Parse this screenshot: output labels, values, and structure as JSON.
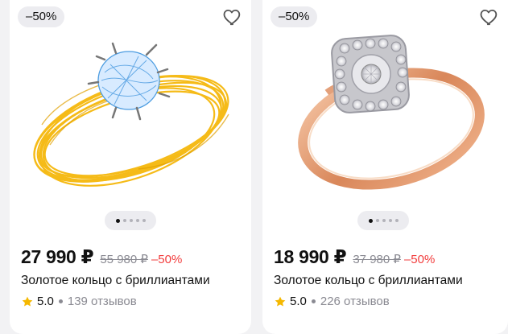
{
  "products": [
    {
      "badge": "–50%",
      "image_alt": "hand-drawn gold ring with blue stone",
      "price": "27 990 ₽",
      "old_price": "55 980 ₽",
      "discount": "–50%",
      "title": "Золотое кольцо с бриллиантами",
      "rating": "5.0",
      "reviews": "139 отзывов",
      "carousel": {
        "count": 5,
        "active": 1
      }
    },
    {
      "badge": "–50%",
      "image_alt": "rose gold ring with diamond cluster",
      "price": "18 990 ₽",
      "old_price": "37 980 ₽",
      "discount": "–50%",
      "title": "Золотое кольцо с бриллиантами",
      "rating": "5.0",
      "reviews": "226 отзывов",
      "carousel": {
        "count": 5,
        "active": 1
      }
    }
  ],
  "icons": {
    "favorite": "heart-outline-icon",
    "rating": "star-icon"
  },
  "colors": {
    "discount": "#f23c3c",
    "star": "#f5b800",
    "muted": "#8a8a92"
  }
}
